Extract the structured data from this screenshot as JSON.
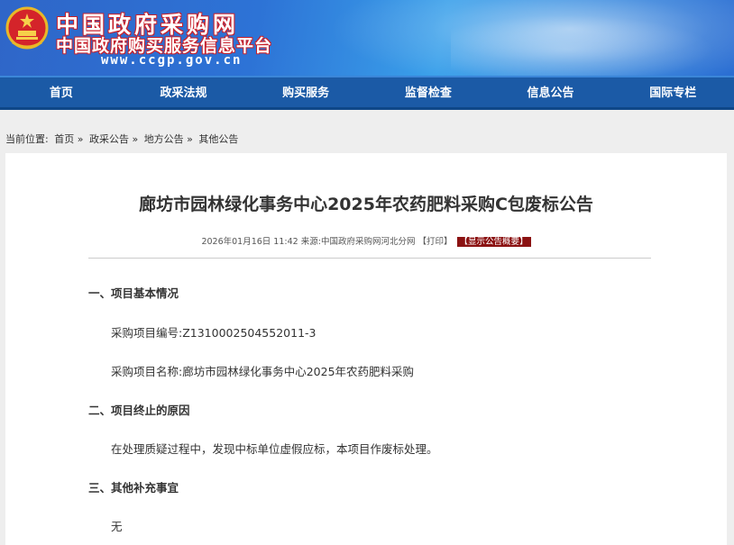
{
  "header": {
    "site_title": "中国政府采购网",
    "site_subtitle": "中国政府购买服务信息平台",
    "site_url": "www.ccgp.gov.cn"
  },
  "nav": {
    "items": [
      "首页",
      "政采法规",
      "购买服务",
      "监督检查",
      "信息公告",
      "国际专栏"
    ]
  },
  "breadcrumb": {
    "label": "当前位置:",
    "items": [
      "首页 »",
      "政采公告 »",
      "地方公告 »",
      "其他公告"
    ]
  },
  "article": {
    "title": "廊坊市园林绿化事务中心2025年农药肥料采购C包废标公告",
    "date": "2026年01月16日 11:42",
    "source_label": "来源:",
    "source": "中国政府采购网河北分网",
    "print_label": "【打印】",
    "show_fee_label": "【显示公告概要】",
    "sections": [
      {
        "heading": "一、项目基本情况",
        "lines": [
          "采购项目编号:Z1310002504552011-3",
          "采购项目名称:廊坊市园林绿化事务中心2025年农药肥料采购"
        ]
      },
      {
        "heading": "二、项目终止的原因",
        "lines": [
          "在处理质疑过程中，发现中标单位虚假应标，本项目作废标处理。"
        ]
      },
      {
        "heading": "三、其他补充事宜",
        "lines": [
          "无"
        ]
      }
    ]
  },
  "colors": {
    "nav_bg": "#1b5aa6",
    "header_blue": "#2d73d6",
    "tag_red": "#8b1212"
  }
}
